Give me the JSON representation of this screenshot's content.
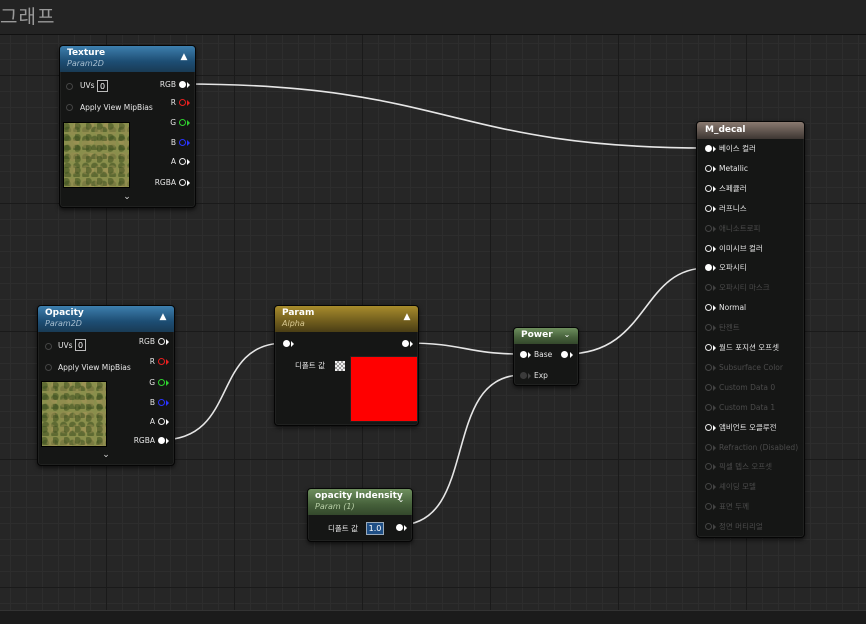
{
  "graph": {
    "title": "그래프"
  },
  "colors": {
    "wire": "#e6e6e6",
    "param_swatch": "#ff0000"
  },
  "texture_node": {
    "title": "Texture",
    "subtitle": "Param2D",
    "inputs": [
      {
        "label": "UVs",
        "value": "0"
      },
      {
        "label": "Apply View MipBias"
      }
    ],
    "outputs": [
      "RGB",
      "R",
      "G",
      "B",
      "A",
      "RGBA"
    ]
  },
  "opacity_node": {
    "title": "Opacity",
    "subtitle": "Param2D",
    "inputs": [
      {
        "label": "UVs",
        "value": "0"
      },
      {
        "label": "Apply View MipBias"
      }
    ],
    "outputs": [
      "RGB",
      "R",
      "G",
      "B",
      "A",
      "RGBA"
    ]
  },
  "param_node": {
    "title": "Param",
    "subtitle": "Alpha",
    "default_label": "디폴트 값"
  },
  "power_node": {
    "title": "Power",
    "inputs": [
      "Base",
      "Exp"
    ]
  },
  "opacity_intensity_node": {
    "title": "opacity Indensity",
    "subtitle": "Param (1)",
    "default_label": "디폴트 값",
    "value": "1.0"
  },
  "material_node": {
    "title": "M_decal",
    "pins": [
      {
        "label": "베이스 컬러",
        "state": "connected"
      },
      {
        "label": "Metallic",
        "state": "active"
      },
      {
        "label": "스페큘러",
        "state": "active"
      },
      {
        "label": "러프니스",
        "state": "active"
      },
      {
        "label": "애니소트로피",
        "state": "disabled"
      },
      {
        "label": "이미시브 컬러",
        "state": "active"
      },
      {
        "label": "오파시티",
        "state": "connected"
      },
      {
        "label": "오파시티 마스크",
        "state": "disabled"
      },
      {
        "label": "Normal",
        "state": "active"
      },
      {
        "label": "탄젠트",
        "state": "disabled"
      },
      {
        "label": "월드 포지션 오프셋",
        "state": "active"
      },
      {
        "label": "Subsurface Color",
        "state": "disabled"
      },
      {
        "label": "Custom Data 0",
        "state": "disabled"
      },
      {
        "label": "Custom Data 1",
        "state": "disabled"
      },
      {
        "label": "앰비언트 오클루전",
        "state": "active"
      },
      {
        "label": "Refraction (Disabled)",
        "state": "disabled"
      },
      {
        "label": "픽셀 뎁스 오프셋",
        "state": "disabled"
      },
      {
        "label": "셰이딩 모델",
        "state": "disabled"
      },
      {
        "label": "표면 두께",
        "state": "disabled"
      },
      {
        "label": "정면 머티리얼",
        "state": "disabled"
      }
    ]
  }
}
